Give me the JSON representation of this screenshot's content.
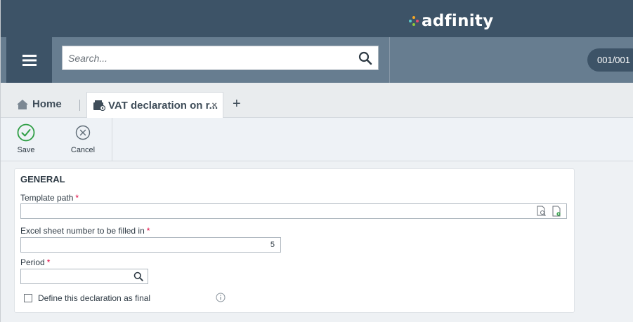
{
  "brand": {
    "name": "adfinity"
  },
  "search": {
    "placeholder": "Search..."
  },
  "company": {
    "code": "001/001"
  },
  "tabs": {
    "home_label": "Home",
    "active_label": "VAT declaration on r...",
    "close_glyph": "×",
    "add_glyph": "+"
  },
  "toolbar": {
    "save_label": "Save",
    "cancel_label": "Cancel"
  },
  "form": {
    "section_title": "GENERAL",
    "template_path": {
      "label": "Template path",
      "required": "*",
      "value": ""
    },
    "sheet_number": {
      "label": "Excel sheet number to be filled in",
      "required": "*",
      "value": "5"
    },
    "period": {
      "label": "Period",
      "required": "*",
      "value": ""
    },
    "final_checkbox": {
      "label": "Define this declaration as final",
      "checked": false
    }
  },
  "colors": {
    "brand_bar": "#3d5367",
    "search_row": "#677d90",
    "save_accent": "#2e9e44",
    "required": "#e0003c"
  },
  "icons": [
    "menu-icon",
    "search-icon",
    "home-icon",
    "document-settings-icon",
    "close-icon",
    "add-icon",
    "check-circle-icon",
    "cancel-circle-icon",
    "file-preview-icon",
    "file-open-icon",
    "info-icon"
  ]
}
